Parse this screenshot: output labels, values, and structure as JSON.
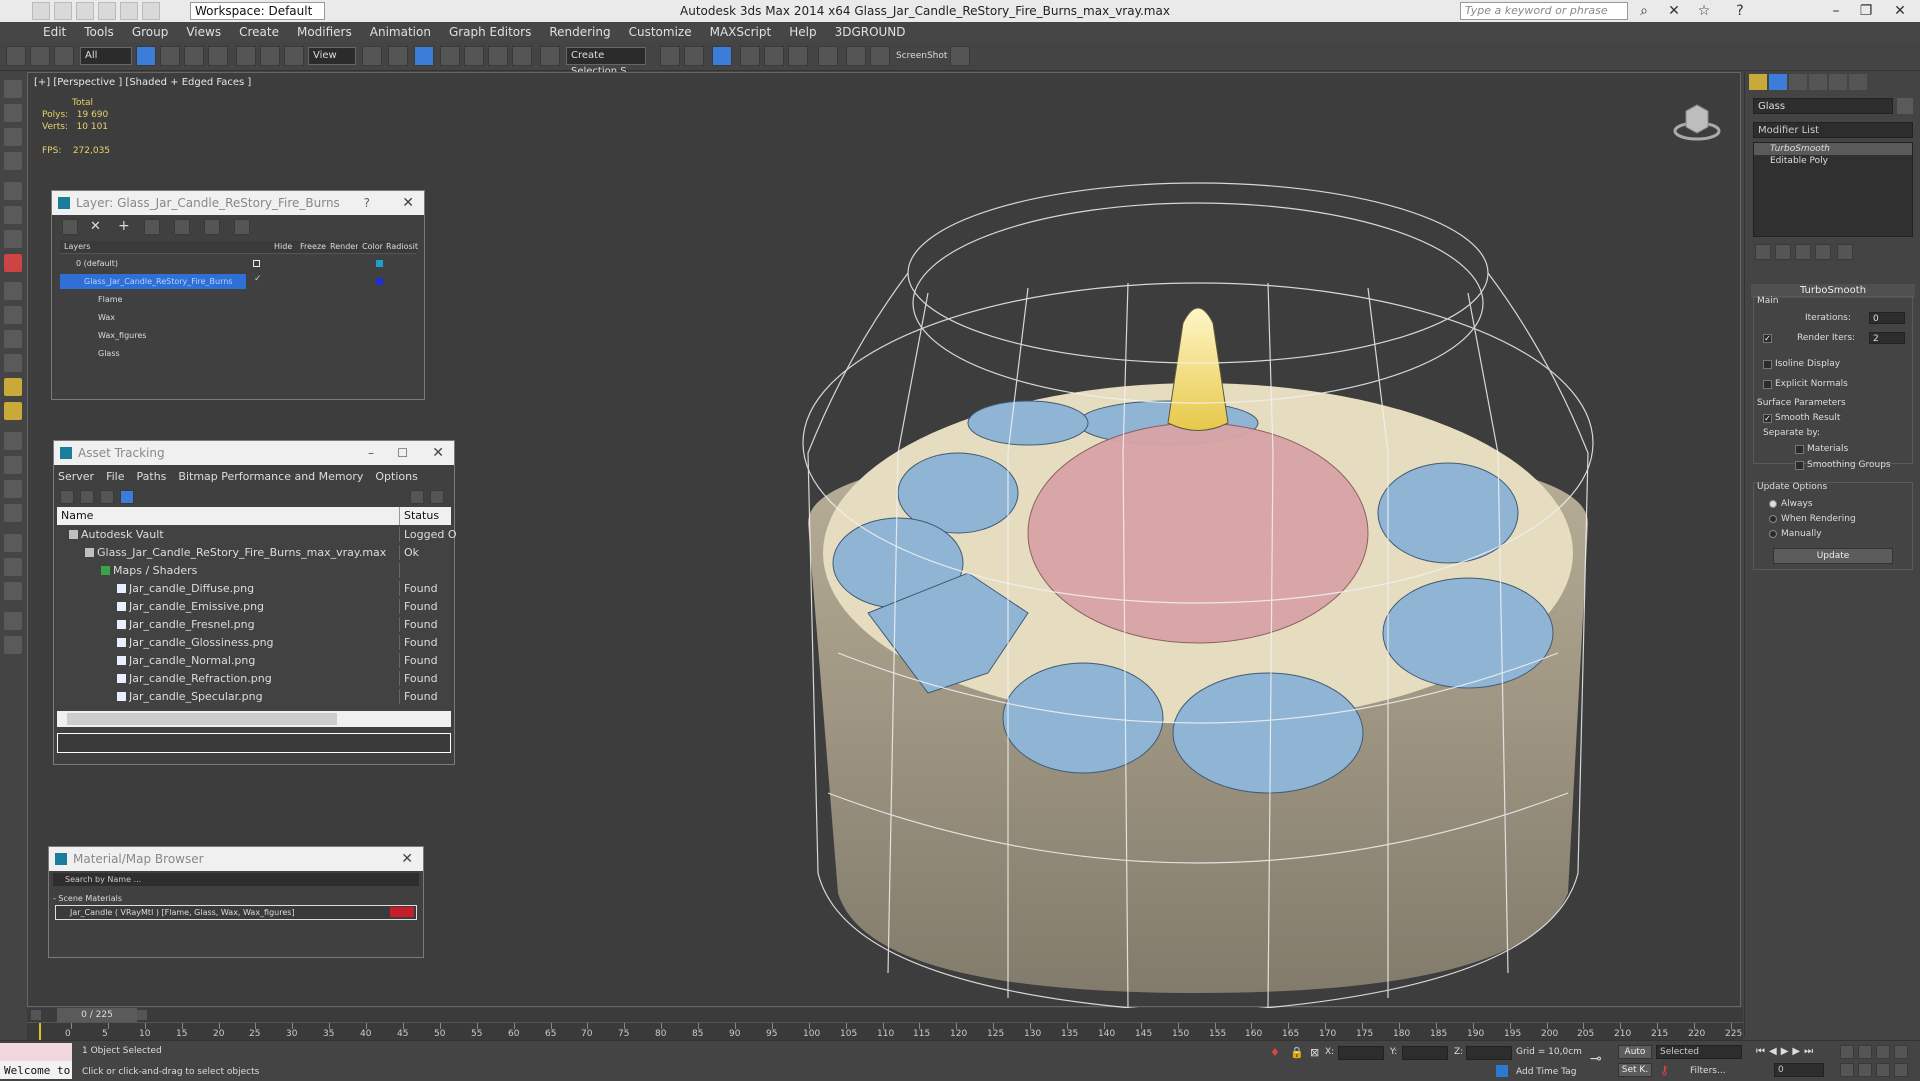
{
  "titlebar": {
    "workspace": "Workspace: Default",
    "title": "Autodesk 3ds Max  2014 x64      Glass_Jar_Candle_ReStory_Fire_Burns_max_vray.max",
    "search_placeholder": "Type a keyword or phrase"
  },
  "menubar": [
    "Edit",
    "Tools",
    "Group",
    "Views",
    "Create",
    "Modifiers",
    "Animation",
    "Graph Editors",
    "Rendering",
    "Customize",
    "MAXScript",
    "Help",
    "3DGROUND"
  ],
  "toolbar": {
    "filter": "All",
    "refcoord": "View",
    "named_selection": "Create Selection S",
    "screenshot_label": "ScreenShot"
  },
  "viewport": {
    "label": "[+] [Perspective ] [Shaded + Edged Faces ]",
    "stats": {
      "total_label": "Total",
      "polys_label": "Polys:",
      "polys_value": "19 690",
      "verts_label": "Verts:",
      "verts_value": "10 101",
      "fps_label": "FPS:",
      "fps_value": "272,035"
    }
  },
  "layer_window": {
    "title": "Layer: Glass_Jar_Candle_ReStory_Fire_Burns",
    "headers": [
      "Layers",
      "Hide",
      "Freeze",
      "Render",
      "Color",
      "Radiosit"
    ],
    "rows": [
      {
        "name": "0 (default)",
        "color": "#1e9ec8"
      },
      {
        "name": "Glass_Jar_Candle_ReStory_Fire_Burns",
        "color": "#1a2fd8",
        "selected": true
      },
      {
        "name": "Flame",
        "color": "#111111"
      },
      {
        "name": "Wax",
        "color": "#111111"
      },
      {
        "name": "Wax_figures",
        "color": "#111111"
      },
      {
        "name": "Glass",
        "color": "#111111"
      }
    ]
  },
  "asset_tracking": {
    "title": "Asset Tracking",
    "menu": [
      "Server",
      "File",
      "Paths",
      "Bitmap Performance and Memory",
      "Options"
    ],
    "col_name": "Name",
    "col_status": "Status",
    "rows": [
      {
        "name": "Autodesk Vault",
        "status": "Logged O",
        "indent": 1
      },
      {
        "name": "Glass_Jar_Candle_ReStory_Fire_Burns_max_vray.max",
        "status": "Ok",
        "indent": 2
      },
      {
        "name": "Maps / Shaders",
        "status": "",
        "indent": 3
      },
      {
        "name": "Jar_candle_Diffuse.png",
        "status": "Found",
        "indent": 4
      },
      {
        "name": "Jar_candle_Emissive.png",
        "status": "Found",
        "indent": 4
      },
      {
        "name": "Jar_candle_Fresnel.png",
        "status": "Found",
        "indent": 4
      },
      {
        "name": "Jar_candle_Glossiness.png",
        "status": "Found",
        "indent": 4
      },
      {
        "name": "Jar_candle_Normal.png",
        "status": "Found",
        "indent": 4
      },
      {
        "name": "Jar_candle_Refraction.png",
        "status": "Found",
        "indent": 4
      },
      {
        "name": "Jar_candle_Specular.png",
        "status": "Found",
        "indent": 4
      }
    ]
  },
  "material_browser": {
    "title": "Material/Map Browser",
    "search_placeholder": "Search by Name ...",
    "section": "- Scene Materials",
    "item": "Jar_Candle  ( VRayMtl ) [Flame, Glass, Wax, Wax_figures]"
  },
  "command_panel": {
    "object_name": "Glass",
    "modifier_list": "Modifier List",
    "stack": [
      "TurboSmooth",
      "Editable Poly"
    ],
    "rollout_title": "TurboSmooth",
    "main_label": "Main",
    "iterations_label": "Iterations:",
    "iterations_value": "0",
    "render_iters_label": "Render Iters:",
    "render_iters_value": "2",
    "isoline_label": "Isoline Display",
    "explicit_normals_label": "Explicit Normals",
    "surface_params_label": "Surface Parameters",
    "smooth_result_label": "Smooth Result",
    "separate_by_label": "Separate by:",
    "materials_label": "Materials",
    "smoothing_groups_label": "Smoothing Groups",
    "update_options_label": "Update Options",
    "always_label": "Always",
    "when_rendering_label": "When Rendering",
    "manually_label": "Manually",
    "update_button": "Update"
  },
  "timeline": {
    "frame": "0 / 225",
    "ticks": [
      "0",
      "5",
      "10",
      "15",
      "20",
      "25",
      "30",
      "35",
      "40",
      "45",
      "50",
      "55",
      "60",
      "65",
      "70",
      "75",
      "80",
      "85",
      "90",
      "95",
      "100",
      "105",
      "110",
      "115",
      "120",
      "125",
      "130",
      "135",
      "140",
      "145",
      "150",
      "155",
      "160",
      "165",
      "170",
      "175",
      "180",
      "185",
      "190",
      "195",
      "200",
      "205",
      "210",
      "215",
      "220",
      "225"
    ]
  },
  "statusbar": {
    "welcome": "Welcome to",
    "selected": "1 Object Selected",
    "prompt": "Click or click-and-drag to select objects",
    "x_label": "X:",
    "y_label": "Y:",
    "z_label": "Z:",
    "grid": "Grid = 10,0cm",
    "auto": "Auto",
    "set_key": "Set K.",
    "selected_dropdown": "Selected",
    "filters": "Filters...",
    "add_time_tag": "Add Time Tag",
    "frame_field": "0"
  }
}
